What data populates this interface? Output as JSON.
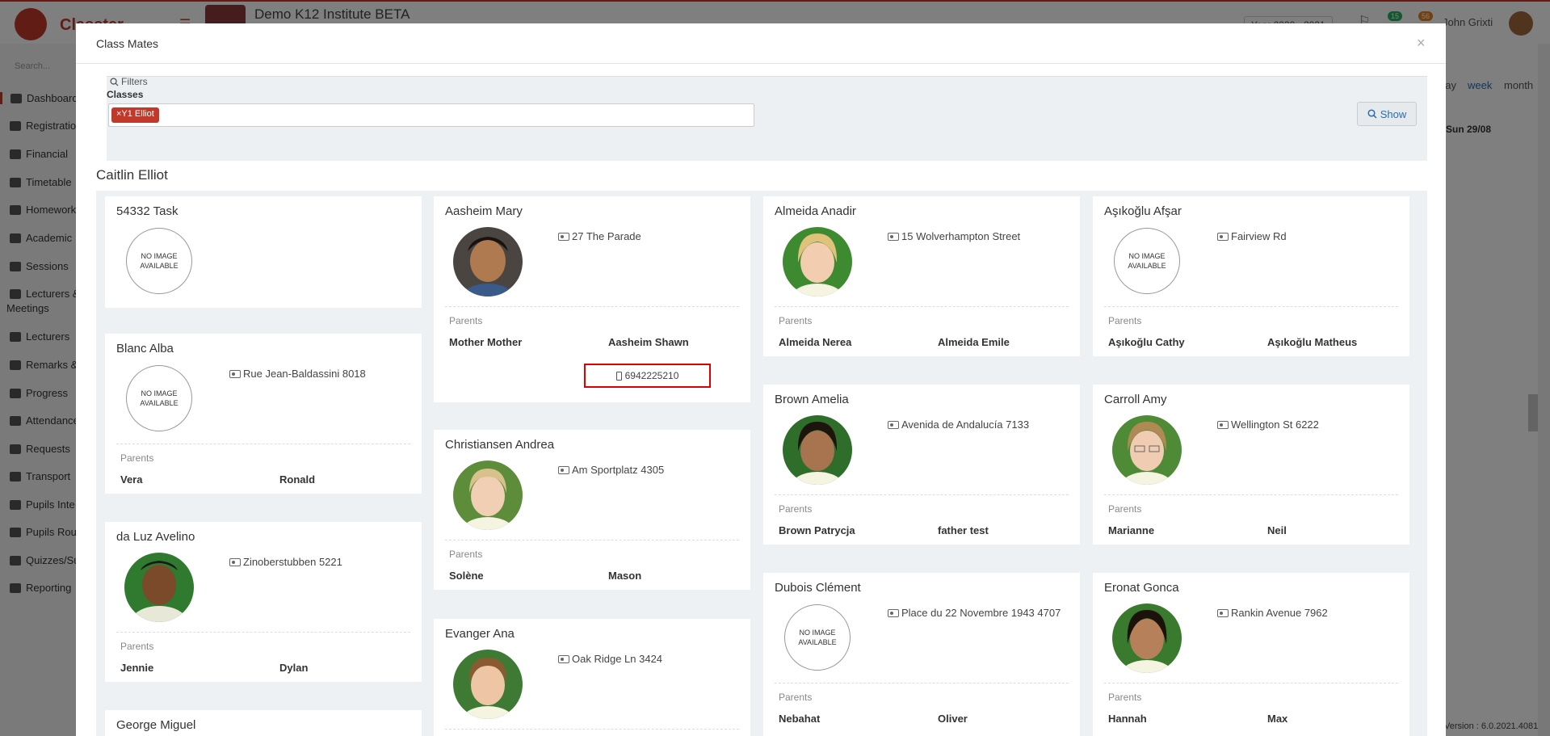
{
  "app": {
    "logo_text": "Classter",
    "school_name": "Demo K12 Institute BETA",
    "year": "Year 2020 - 2021",
    "notif_badge_1": "15",
    "notif_badge_2": "56",
    "user_name": "John Grixti",
    "search_placeholder": "Search...",
    "version": "Version : 6.0.2021.4081"
  },
  "sidebar": {
    "items": [
      {
        "label": "Dashboard"
      },
      {
        "label": "Registration"
      },
      {
        "label": "Financial"
      },
      {
        "label": "Timetable"
      },
      {
        "label": "Homework"
      },
      {
        "label": "Academic"
      },
      {
        "label": "Sessions"
      },
      {
        "label": "Lecturers &"
      },
      {
        "label": "Meetings"
      },
      {
        "label": "Lecturers"
      },
      {
        "label": "Remarks &"
      },
      {
        "label": "Progress"
      },
      {
        "label": "Attendance"
      },
      {
        "label": "Requests"
      },
      {
        "label": "Transport"
      },
      {
        "label": "Pupils Inte"
      },
      {
        "label": "Pupils Rou"
      },
      {
        "label": "Quizzes/Su"
      },
      {
        "label": "Reporting"
      }
    ]
  },
  "calendar": {
    "day_label": "day",
    "week_label": "week",
    "month_label": "month",
    "date_label": "Sun 29/08"
  },
  "modal": {
    "title": "Class Mates",
    "close_symbol": "×",
    "filters_legend": "Filters",
    "classes_label": "Classes",
    "class_tag": "×Y1 Elliot",
    "show_label": "Show",
    "section_title": "Caitlin Elliot",
    "parents_label": "Parents",
    "no_image_text": "NO IMAGE AVAILABLE"
  },
  "students": [
    {
      "name": "54332 Task",
      "address": "",
      "parents": []
    },
    {
      "name": "Aasheim Mary",
      "address": "27 The Parade",
      "parents": [
        "Mother Mother",
        "Aasheim Shawn"
      ],
      "phone": "6942225210"
    },
    {
      "name": "Almeida Anadir",
      "address": "15 Wolverhampton Street",
      "parents": [
        "Almeida Nerea",
        "Almeida Emile"
      ]
    },
    {
      "name": "Aşıkoğlu Afşar",
      "address": "Fairview Rd",
      "parents": [
        "Aşıkoğlu Cathy",
        "Aşıkoğlu Matheus"
      ]
    },
    {
      "name": "Blanc Alba",
      "address": "Rue Jean-Baldassini 8018",
      "parents": [
        "Vera",
        "Ronald"
      ]
    },
    {
      "name": "Christiansen Andrea",
      "address": "Am Sportplatz 4305",
      "parents": [
        "Solène",
        "Mason"
      ]
    },
    {
      "name": "Brown Amelia",
      "address": "Avenida de Andalucía 7133",
      "parents": [
        "Brown Patrycja",
        "father test"
      ]
    },
    {
      "name": "Carroll Amy",
      "address": "Wellington St 6222",
      "parents": [
        "Marianne",
        "Neil"
      ]
    },
    {
      "name": "da Luz Avelino",
      "address": "Zinoberstubben 5221",
      "parents": [
        "Jennie",
        "Dylan"
      ]
    },
    {
      "name": "Evanger Ana",
      "address": "Oak Ridge Ln 3424",
      "parents": []
    },
    {
      "name": "Dubois Clément",
      "address": "Place du 22 Novembre 1943 4707",
      "parents": [
        "Nebahat",
        "Oliver"
      ]
    },
    {
      "name": "Eronat Gonca",
      "address": "Rankin Avenue 7962",
      "parents": [
        "Hannah",
        "Max"
      ]
    },
    {
      "name": "George Miguel",
      "address": "",
      "parents": []
    }
  ],
  "colors": {
    "brand": "#c0392b",
    "highlight": "#dd0000",
    "link": "#2a6db0"
  }
}
